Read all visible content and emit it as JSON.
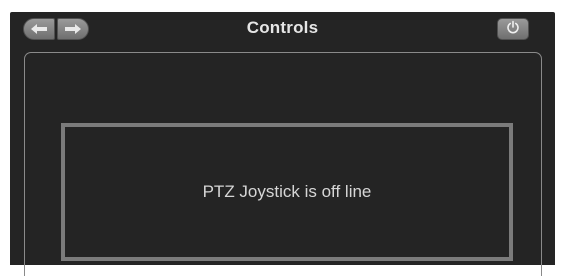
{
  "window": {
    "title": "Controls"
  },
  "toolbar": {
    "back_icon": "arrow-left-icon",
    "forward_icon": "arrow-right-icon",
    "power_icon": "power-icon"
  },
  "ptz": {
    "status_text": "PTZ Joystick is off line"
  },
  "colors": {
    "background": "#242424",
    "button": "#8a8a8a",
    "border": "#7b7b7b",
    "text": "#d6d6d6"
  }
}
